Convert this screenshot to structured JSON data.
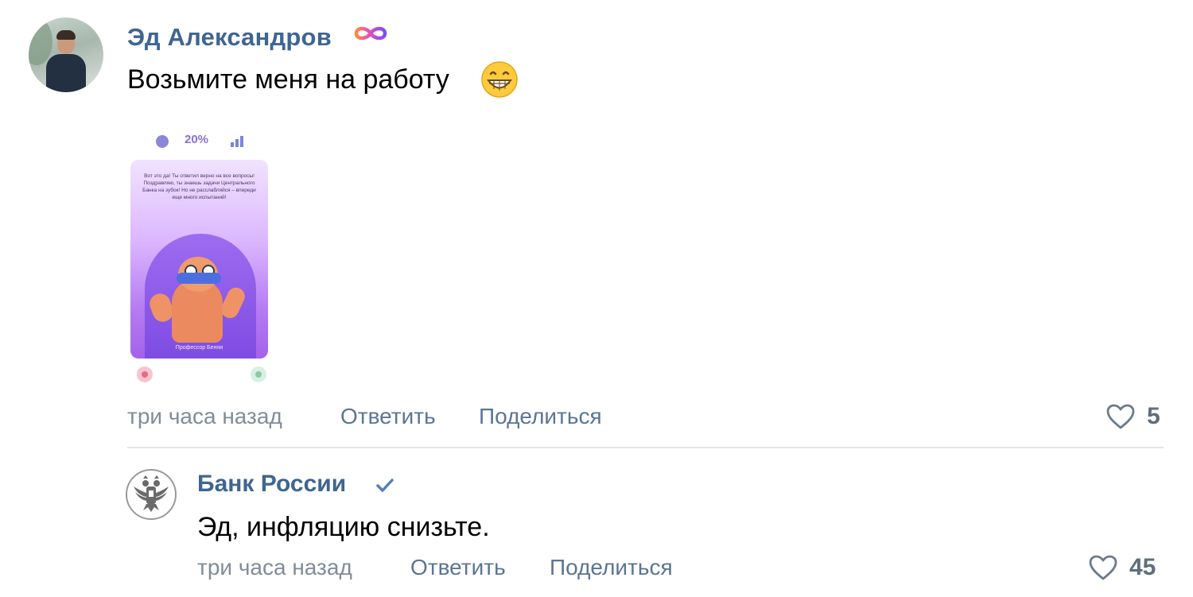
{
  "comment": {
    "author": "Эд Александров",
    "text": "Возьмите меня на работу",
    "attachment": {
      "progress_label": "20%",
      "card_text": "Вот это да! Ты ответил верно на все вопросы! Поздравляю, ты знаешь задачи Центрального Банка на зубок! Но не расслабляйся – впереди еще много испытаний!",
      "card_footer": "Профессор Бенни"
    },
    "time": "три часа назад",
    "reply_label": "Ответить",
    "share_label": "Поделиться",
    "likes": "5"
  },
  "reply": {
    "author": "Банк России",
    "text": "Эд, инфляцию снизьте.",
    "time": "три часа назад",
    "reply_label": "Ответить",
    "share_label": "Поделиться",
    "likes": "45"
  },
  "icons": {
    "author_badge": "infinity-icon",
    "emoji": "grinning-emoji-icon",
    "verified": "checkmark-icon",
    "like": "heart-icon"
  },
  "colors": {
    "name": "#3f6592",
    "link": "#5b7594",
    "muted": "#818c99",
    "verified": "#5181b8"
  }
}
